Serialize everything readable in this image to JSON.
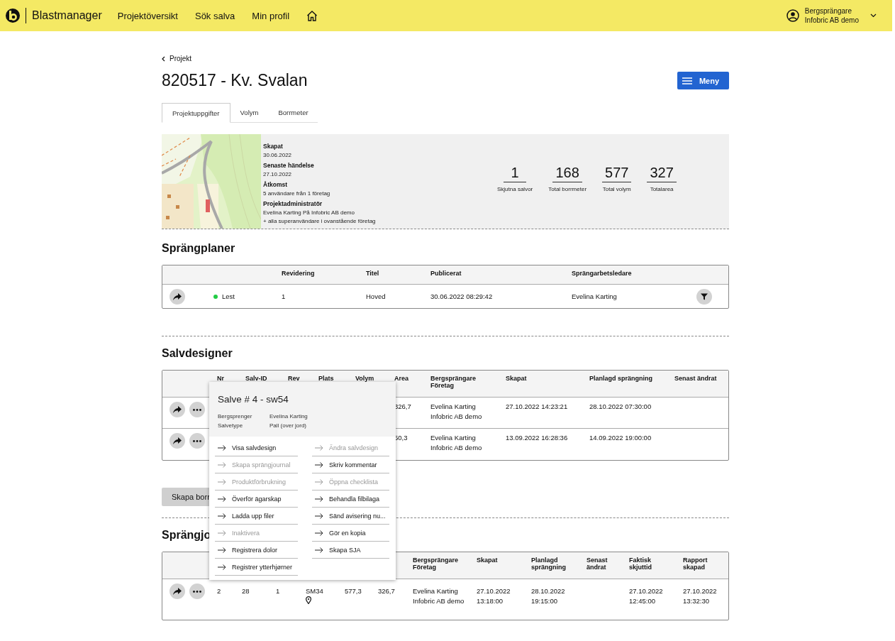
{
  "topbar": {
    "brand": "Blastmanager",
    "nav": [
      {
        "label": "Projektöversikt"
      },
      {
        "label": "Sök salva"
      },
      {
        "label": "Min profil"
      }
    ],
    "user": {
      "role": "Bergsprängare",
      "company": "Infobric AB demo"
    }
  },
  "breadcrumb": "Projekt",
  "title": "820517 - Kv. Svalan",
  "menu_button": "Meny",
  "tabs": [
    {
      "label": "Projektuppgifter",
      "selected": true
    },
    {
      "label": "Volym",
      "selected": false
    },
    {
      "label": "Borrmeter",
      "selected": false
    }
  ],
  "project_info": [
    {
      "label": "Skapat",
      "lines": [
        "30.06.2022"
      ]
    },
    {
      "label": "Senaste händelse",
      "lines": [
        "27.10.2022"
      ]
    },
    {
      "label": "Åtkomst",
      "lines": [
        "5 användare från 1 företag"
      ]
    },
    {
      "label": "Projektadministratör",
      "lines": [
        "Evelina Karting På Infobric AB demo",
        "+ alla superanvändare i ovanstående företag"
      ]
    }
  ],
  "stats": [
    {
      "value": "1",
      "label": "Skjutna salvor"
    },
    {
      "value": "168",
      "label": "Total borrmeter"
    },
    {
      "value": "577",
      "label": "Total volym"
    },
    {
      "value": "327",
      "label": "Totalarea"
    }
  ],
  "sprangplaner": {
    "heading": "Sprängplaner",
    "columns": [
      "Revidering",
      "Titel",
      "Publicerat",
      "Sprängarbetsledare"
    ],
    "rows": [
      {
        "status": "Lest",
        "color": "#22cc44",
        "revidering": "1",
        "titel": "Hoved",
        "publicerat": "30.06.2022 08:29:42",
        "ledare": "Evelina Karting"
      }
    ]
  },
  "salvdesigner": {
    "heading": "Salvdesigner",
    "columns": [
      "Nr",
      "Salv-ID",
      "Rev",
      "Plats",
      "Volym",
      "Area",
      "Bergsprängare Företag",
      "Skapat",
      "Planlagd sprängning",
      "Senast ändrat"
    ],
    "rows": [
      {
        "area": "326,7",
        "bergsprangare": "Evelina Karting",
        "foretag": "Infobric AB demo",
        "skapat": "27.10.2022 14:23:21",
        "planlagd": "28.10.2022 07:30:00"
      },
      {
        "area": "50,3",
        "bergsprangare": "Evelina Karting",
        "foretag": "Infobric AB demo",
        "skapat": "13.09.2022 16:28:36",
        "planlagd": "14.09.2022 19:00:00"
      }
    ],
    "button": "Skapa borr"
  },
  "popup": {
    "title": "Salve # 4 - sw54",
    "details": [
      {
        "label": "Bergsprenger",
        "value": "Evelina Karting"
      },
      {
        "label": "Salvetype",
        "value": "Pall (over jord)"
      }
    ],
    "left": [
      {
        "label": "Visa salvdesign",
        "disabled": false
      },
      {
        "label": "Skapa sprängjournal",
        "disabled": true
      },
      {
        "label": "Produktförbrukning",
        "disabled": true
      },
      {
        "label": "Överför ägarskap",
        "disabled": false
      },
      {
        "label": "Ladda upp filer",
        "disabled": false
      },
      {
        "label": "Inaktivera",
        "disabled": true
      },
      {
        "label": "Registrera dolor",
        "disabled": false
      },
      {
        "label": "Registrer ytterhjørner",
        "disabled": false
      }
    ],
    "right": [
      {
        "label": "Ändra salvdesign",
        "disabled": true
      },
      {
        "label": "Skriv kommentar",
        "disabled": false
      },
      {
        "label": "Öppna checklista",
        "disabled": true
      },
      {
        "label": "Behandla filbilaga",
        "disabled": false
      },
      {
        "label": "Sänd avisering nu...",
        "disabled": false
      },
      {
        "label": "Gör en kopia",
        "disabled": false
      },
      {
        "label": "Skapa SJA",
        "disabled": false
      }
    ]
  },
  "sprangjournaler": {
    "heading": "Sprängjo",
    "columns": [
      "Bergsprängare Företag",
      "Skapat",
      "Planlagd sprängning",
      "Senast ändrat",
      "Faktisk skjuttid",
      "Rapport skapad"
    ],
    "rows": [
      {
        "nr": "2",
        "salv_id": "28",
        "rev": "1",
        "plats": "SM34",
        "volym": "577,3",
        "area": "326,7",
        "bergsprangare": "Evelina Karting Infobric AB demo",
        "skapat": "27.10.2022 13:18:00",
        "planlagd": "28.10.2022 19:15:00",
        "faktisk": "27.10.2022 12:45:00",
        "rapport": "27.10.2022 13:32:30"
      }
    ]
  }
}
